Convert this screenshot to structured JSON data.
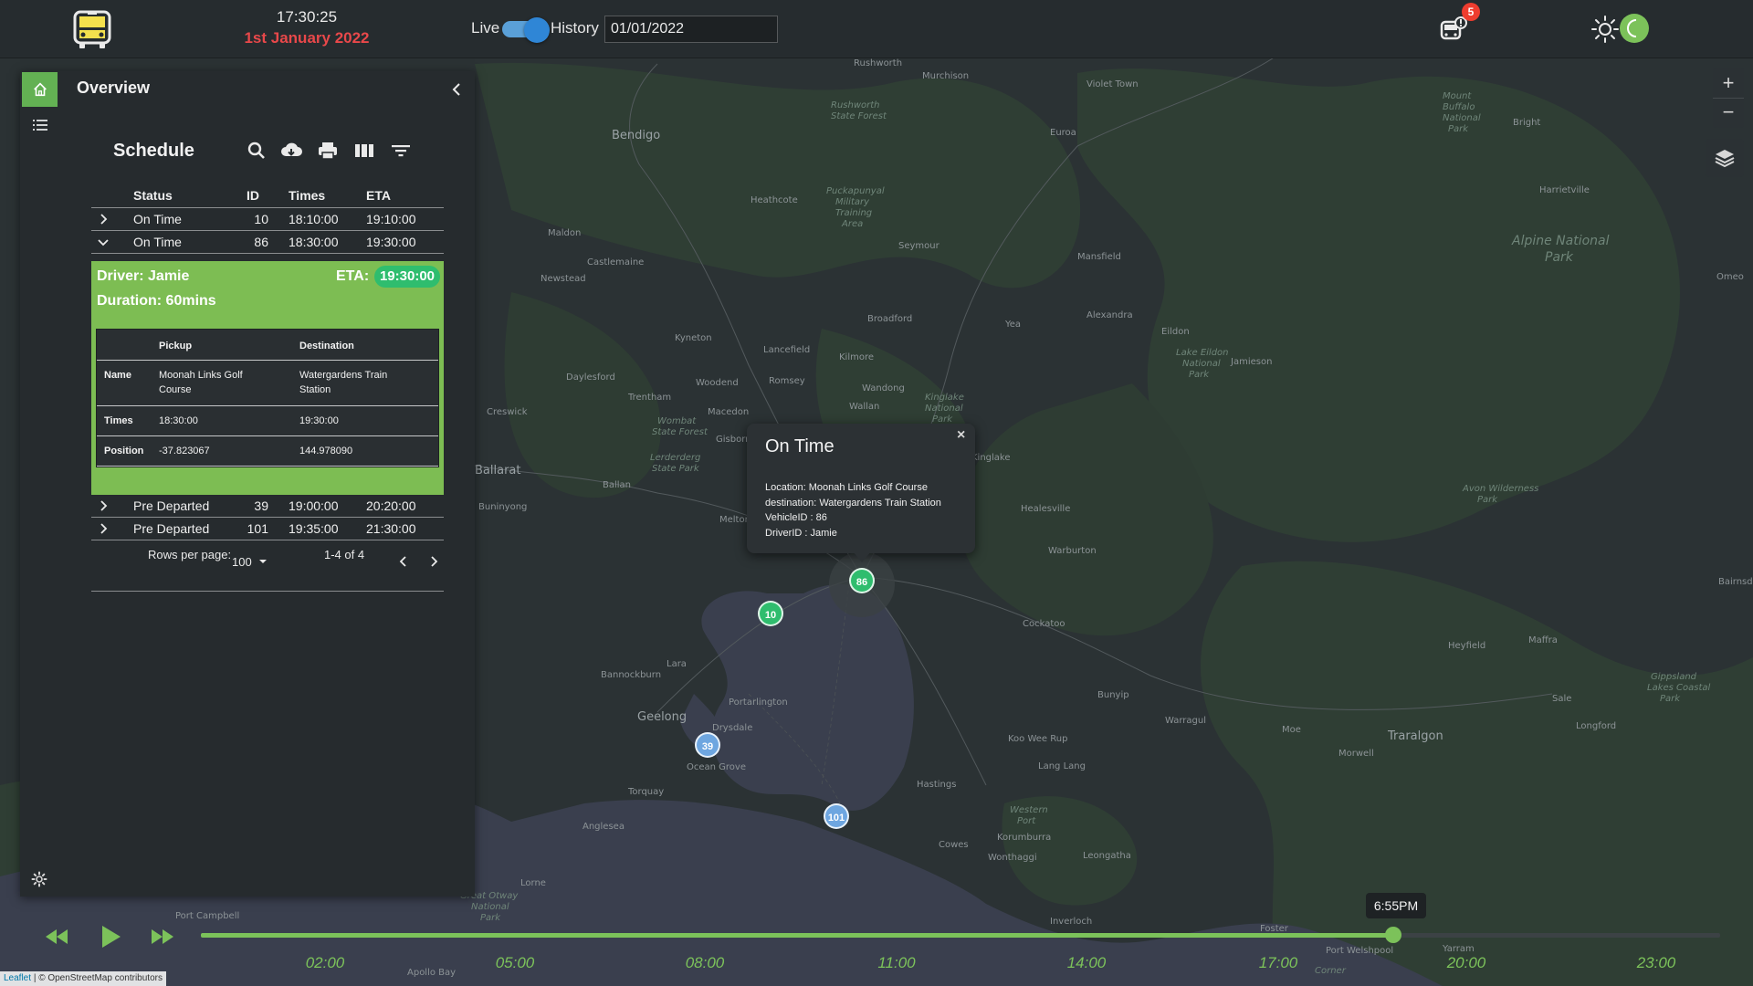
{
  "header": {
    "time": "17:30:25",
    "date": "1st January 2022",
    "live_label": "Live",
    "history_label": "History",
    "history_date": "01/01/2022",
    "notification_count": "5",
    "toggle_on": true
  },
  "drawer": {
    "title": "Overview",
    "schedule_title": "Schedule",
    "columns": {
      "status": "Status",
      "id": "ID",
      "times": "Times",
      "eta": "ETA"
    },
    "rows": [
      {
        "status": "On Time",
        "id": "10",
        "times": "18:10:00",
        "eta": "19:10:00",
        "expanded": false
      },
      {
        "status": "On Time",
        "id": "86",
        "times": "18:30:00",
        "eta": "19:30:00",
        "expanded": true
      },
      {
        "status": "Pre Departed",
        "id": "39",
        "times": "19:00:00",
        "eta": "20:20:00",
        "expanded": false
      },
      {
        "status": "Pre Departed",
        "id": "101",
        "times": "19:35:00",
        "eta": "21:30:00",
        "expanded": false
      }
    ],
    "detail": {
      "driver": "Driver: Jamie",
      "duration": "Duration: 60mins",
      "eta_label": "ETA:",
      "eta_value": "19:30:00",
      "headers": {
        "pickup": "Pickup",
        "destination": "Destination"
      },
      "name_label": "Name",
      "pickup_name": "Moonah Links Golf Course",
      "destination_name": "Watergardens Train Station",
      "times_label": "Times",
      "pickup_time": "18:30:00",
      "destination_time": "19:30:00",
      "position_label": "Position",
      "latitude": "-37.823067",
      "longitude": "144.978090"
    },
    "pager": {
      "rows_per_page_label": "Rows per page:",
      "rows_per_page": "100",
      "range": "1-4 of 4"
    }
  },
  "popup": {
    "title": "On Time",
    "location": "Location: Moonah Links Golf Course",
    "destination": "destination: Watergardens Train Station",
    "vehicle": "VehicleID : 86",
    "driver": "DriverID : Jamie",
    "close": "×"
  },
  "map": {
    "zoom_in": "+",
    "zoom_out": "−",
    "markers": [
      {
        "id": "10",
        "color": "#2fbd6e"
      },
      {
        "id": "86",
        "color": "#2fbd6e"
      },
      {
        "id": "39",
        "color": "#6ea6e0"
      },
      {
        "id": "101",
        "color": "#6ea6e0"
      }
    ],
    "attribution_leaflet": "Leaflet",
    "attribution_rest": "| © OpenStreetMap contributors",
    "places": [
      "Rushworth",
      "Murchison",
      "Violet Town",
      "Bendigo",
      "Rushworth State Forest",
      "Euroa",
      "Mount Buffalo National Park",
      "Bright",
      "Heathcote",
      "Puckapunyal Military Training Area",
      "Harrietville",
      "Maldon",
      "Seymour",
      "Alpine National Park",
      "Castlemaine",
      "Mansfield",
      "Newstead",
      "Kyneton",
      "Broadford",
      "Alexandra",
      "Yea",
      "Eildon",
      "Lake Eildon National Park",
      "Jamieson",
      "Lancefield",
      "Kilmore",
      "Daylesford",
      "Romsey",
      "Woodend",
      "Trentham",
      "Wandong",
      "Creswick",
      "Macedon",
      "Wallan",
      "Kinglake National Park",
      "Wombat State Forest",
      "Gisborne",
      "Kinglake",
      "Lerderderg State Park",
      "Ballarat",
      "Bunninyong",
      "Ballan",
      "Melton",
      "Healesville",
      "Warburton",
      "Avon Wilderness Park",
      "Omeo",
      "Bairnsdale",
      "Cockatoo",
      "Bannockburn",
      "Heyfield",
      "Maffra",
      "Lara",
      "Geelong",
      "Portarlington",
      "Drysdale",
      "Bunyip",
      "Warragul",
      "Moe",
      "Sale",
      "Traralgon",
      "Longford",
      "Morwell",
      "Koo Wee Rup",
      "Lang Lang",
      "Gippsland Lakes Coastal Park",
      "Ocean Grove",
      "Torquay",
      "Hastings",
      "Anglesea",
      "Korumburra",
      "Leongatha",
      "Cowes",
      "Lorne",
      "Great Otway National Park",
      "Port Campbell",
      "Apollo Bay",
      "Inverloch",
      "Foster",
      "Port Welshpool",
      "Corner Inlet",
      "Yarram"
    ]
  },
  "timeline": {
    "current": "6:55PM",
    "progress": 0.785,
    "ticks": [
      "02:00",
      "05:00",
      "08:00",
      "11:00",
      "14:00",
      "17:00",
      "20:00",
      "23:00"
    ]
  }
}
